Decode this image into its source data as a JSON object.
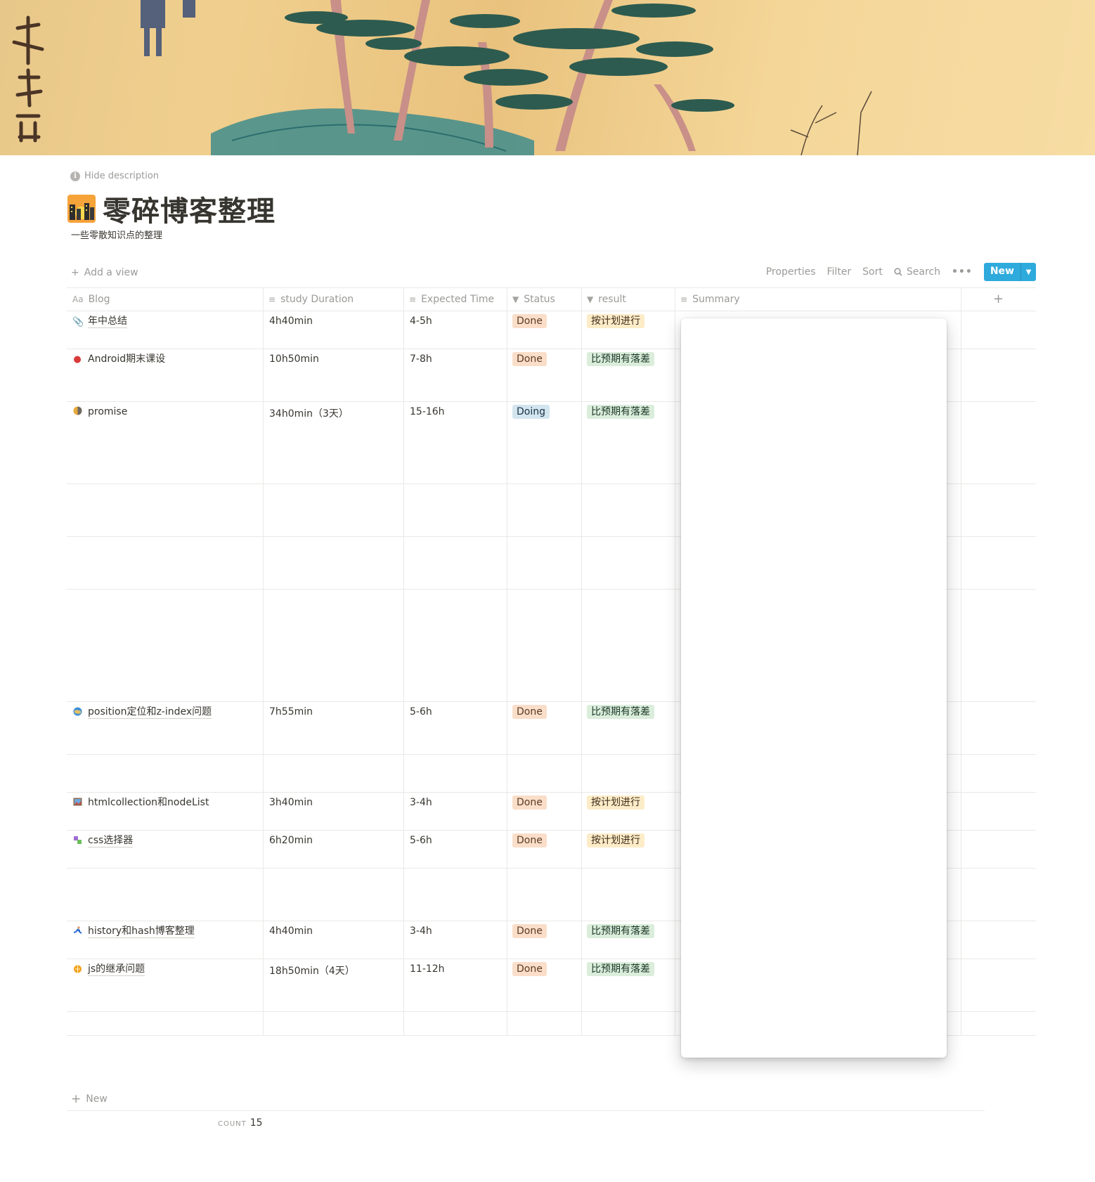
{
  "page": {
    "hide_description": "Hide description",
    "title": "零碎博客整理",
    "description": "一些零散知识点的整理"
  },
  "toolbar": {
    "add_view": "Add a view",
    "properties": "Properties",
    "filter": "Filter",
    "sort": "Sort",
    "search": "Search",
    "more": "•••",
    "new": "New"
  },
  "columns": {
    "blog": "Blog",
    "study_duration": "study Duration",
    "expected_time": "Expected Time",
    "status": "Status",
    "result": "result",
    "summary": "Summary"
  },
  "rows": [
    {
      "blog": "年中总结",
      "duration": "4h40min",
      "expected": "4-5h",
      "status": "Done",
      "result": "按计划进行"
    },
    {
      "blog": "Android期末课设",
      "duration": "10h50min",
      "expected": "7-8h",
      "status": "Done",
      "result": "比预期有落差"
    },
    {
      "blog": "promise",
      "duration": "34h0min（3天）",
      "expected": "15-16h",
      "status": "Doing",
      "result": "比预期有落差"
    },
    {
      "blog": "position定位和z-index问题",
      "duration": "7h55min",
      "expected": "5-6h",
      "status": "Done",
      "result": "比预期有落差"
    },
    {
      "blog": "htmlcollection和nodeList",
      "duration": "3h40min",
      "expected": "3-4h",
      "status": "Done",
      "result": "按计划进行"
    },
    {
      "blog": "css选择器",
      "duration": "6h20min",
      "expected": "5-6h",
      "status": "Done",
      "result": "按计划进行"
    },
    {
      "blog": "history和hash博客整理",
      "duration": "4h40min",
      "expected": "3-4h",
      "status": "Done",
      "result": "比预期有落差"
    },
    {
      "blog": "js的继承问题",
      "duration": "18h50min（4天）",
      "expected": "11-12h",
      "status": "Done",
      "result": "比预期有落差"
    }
  ],
  "footer": {
    "new_row": "New",
    "count_label": "COUNT",
    "count_value": "15"
  },
  "colors": {
    "accent": "#2eaadc",
    "done": "#fadec9",
    "doing": "#d3e5ef",
    "plan": "#fdecc8",
    "gap": "#dbeddb"
  }
}
